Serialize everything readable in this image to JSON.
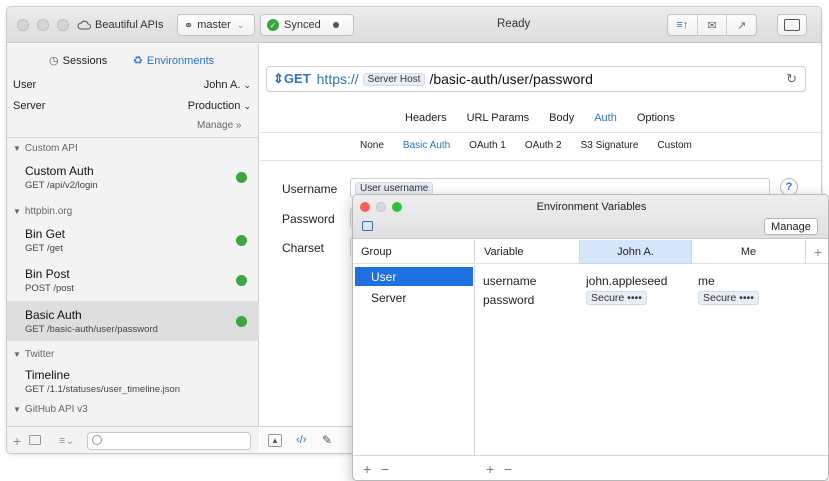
{
  "toolbar": {
    "project": "Beautiful APIs",
    "branch": "master",
    "sync_status": "Synced",
    "status": "Ready"
  },
  "sidebar": {
    "tab_sessions": "Sessions",
    "tab_environments": "Environments",
    "env_rows": [
      {
        "label": "User",
        "value": "John A."
      },
      {
        "label": "Server",
        "value": "Production"
      }
    ],
    "manage": "Manage »",
    "groups": [
      {
        "name": "Custom API"
      },
      {
        "name": "httpbin.org"
      },
      {
        "name": "Twitter"
      },
      {
        "name": "GitHub API v3"
      }
    ],
    "requests": [
      {
        "title": "Custom Auth",
        "sub": "GET /api/v2/login"
      },
      {
        "title": "Bin Get",
        "sub": "GET /get"
      },
      {
        "title": "Bin Post",
        "sub": "POST /post"
      },
      {
        "title": "Basic Auth",
        "sub": "GET /basic-auth/user/password"
      },
      {
        "title": "Timeline",
        "sub": "GET /1.1/statuses/user_timeline.json"
      }
    ],
    "status_color": "#3fa33f"
  },
  "request": {
    "method": "GET",
    "scheme": "https://",
    "host_token": "Server Host",
    "path": "/basic-auth/user/password",
    "tabs": [
      "Headers",
      "URL Params",
      "Body",
      "Auth",
      "Options"
    ],
    "auth_types": [
      "None",
      "Basic Auth",
      "OAuth 1",
      "OAuth 2",
      "S3 Signature",
      "Custom"
    ],
    "fields": {
      "username_label": "Username",
      "username_token": "User username",
      "password_label": "Password",
      "charset_label": "Charset"
    },
    "help": "?"
  },
  "env_window": {
    "title": "Environment Variables",
    "manage": "Manage",
    "col_group": "Group",
    "col_variable": "Variable",
    "col_john": "John A.",
    "col_me": "Me",
    "add": "+",
    "groups": [
      "User",
      "Server"
    ],
    "variables": [
      {
        "name": "username",
        "john": "john.appleseed",
        "me": "me"
      },
      {
        "name": "password",
        "john": "Secure ••••",
        "me": "Secure ••••"
      }
    ],
    "footer_plus": "+",
    "footer_minus": "−"
  },
  "colors": {
    "accent": "#2b72c9",
    "selection": "#1e6fe0"
  }
}
